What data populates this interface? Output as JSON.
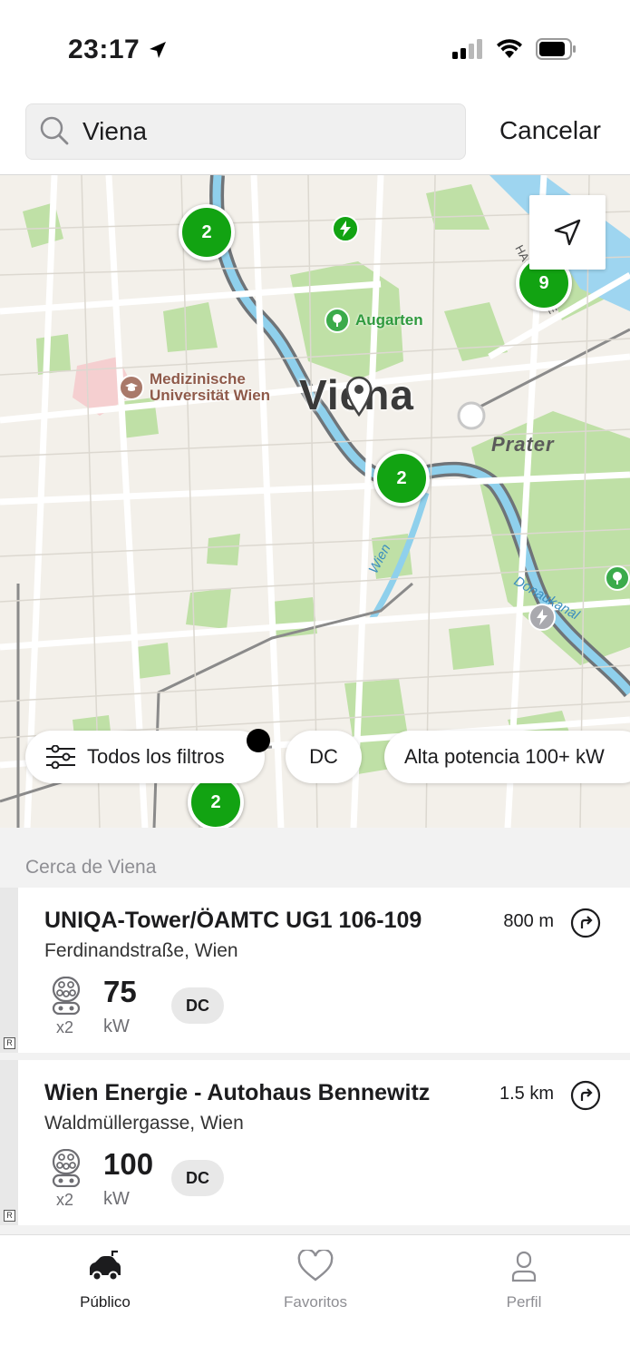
{
  "status_bar": {
    "time": "23:17"
  },
  "search": {
    "value": "Viena",
    "cancel_label": "Cancelar"
  },
  "map": {
    "city_label": "Viena",
    "district_label": "Prater",
    "pois": {
      "augarten": "Augarten",
      "medizinische_line1": "Medizinische",
      "medizinische_line2": "Universität Wien"
    },
    "river_labels": {
      "wien": "Wien",
      "donaukanal": "Donaukanal",
      "hauptallee": "HAUPTALLEE"
    },
    "clusters": {
      "top_left": "2",
      "top_right": "9",
      "center": "2",
      "bottom": "2"
    },
    "filter_chips": {
      "all_filters": "Todos los filtros",
      "dc": "DC",
      "high_power": "Alta potencia 100+ kW"
    },
    "accent_color": "#12a312"
  },
  "list": {
    "section_title": "Cerca de Viena",
    "stations": [
      {
        "name": "UNIQA-Tower/ÖAMTC UG1 106-109",
        "address": "Ferdinandstraße, Wien",
        "distance": "800 m",
        "connector_count": "x2",
        "power": "75",
        "power_unit": "kW",
        "type": "DC"
      },
      {
        "name": "Wien Energie - Autohaus Bennewitz",
        "address": "Waldmüllergasse, Wien",
        "distance": "1.5 km",
        "connector_count": "x2",
        "power": "100",
        "power_unit": "kW",
        "type": "DC"
      }
    ]
  },
  "tabs": [
    {
      "label": "Público",
      "icon": "car-charging-icon",
      "active": true
    },
    {
      "label": "Favoritos",
      "icon": "heart-icon",
      "active": false
    },
    {
      "label": "Perfil",
      "icon": "person-icon",
      "active": false
    }
  ]
}
